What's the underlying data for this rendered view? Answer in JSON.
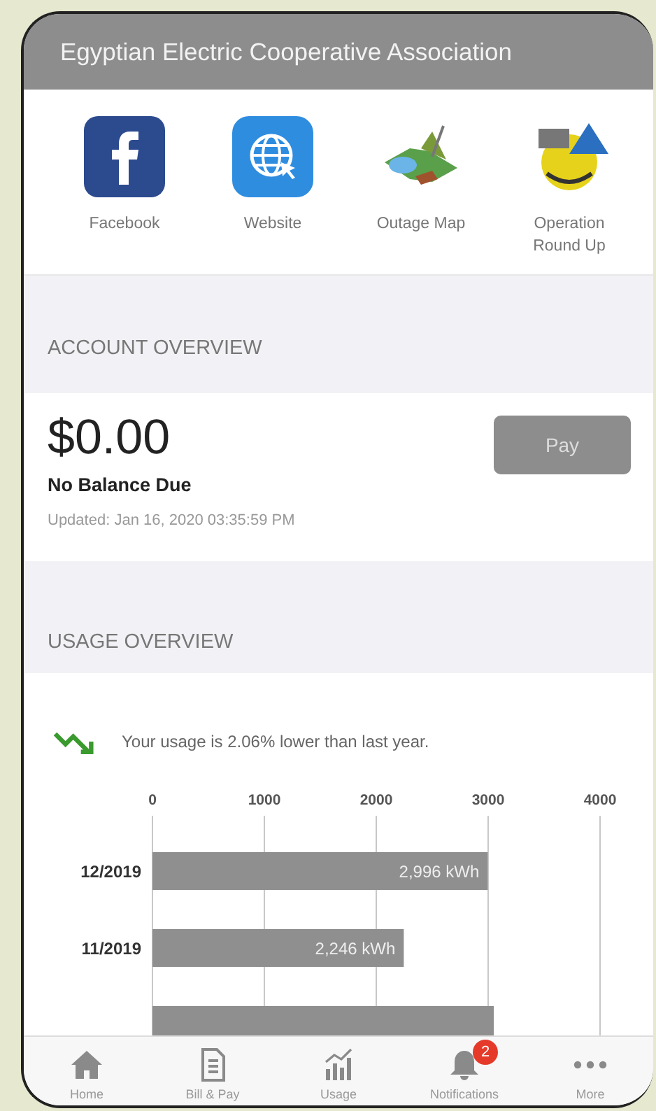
{
  "header": {
    "title": "Egyptian Electric Cooperative Association"
  },
  "shortcuts": [
    {
      "kind": "facebook",
      "label": "Facebook"
    },
    {
      "kind": "website",
      "label": "Website"
    },
    {
      "kind": "map",
      "label": "Outage Map"
    },
    {
      "kind": "roundup",
      "label": "Operation Round Up"
    }
  ],
  "account": {
    "section_title": "ACCOUNT OVERVIEW",
    "balance": "$0.00",
    "status": "No Balance Due",
    "updated": "Updated: Jan 16, 2020 03:35:59 PM",
    "pay_button": "Pay"
  },
  "usage": {
    "section_title": "USAGE OVERVIEW",
    "trend": "Your usage is 2.06% lower than last year.",
    "chart_data": {
      "type": "bar",
      "orientation": "horizontal",
      "categories": [
        "12/2019",
        "11/2019",
        null
      ],
      "values": [
        2996,
        2246,
        3050
      ],
      "xlim": [
        0,
        4000
      ],
      "xticks": [
        0,
        1000,
        2000,
        3000,
        4000
      ],
      "grid": true,
      "value_labels": [
        "2,996 kWh",
        "2,246 kWh",
        null
      ]
    }
  },
  "tabs": [
    {
      "kind": "home",
      "label": "Home"
    },
    {
      "kind": "bill",
      "label": "Bill & Pay"
    },
    {
      "kind": "usage",
      "label": "Usage"
    },
    {
      "kind": "notifications",
      "label": "Notifications",
      "badge": "2"
    },
    {
      "kind": "more",
      "label": "More"
    }
  ]
}
